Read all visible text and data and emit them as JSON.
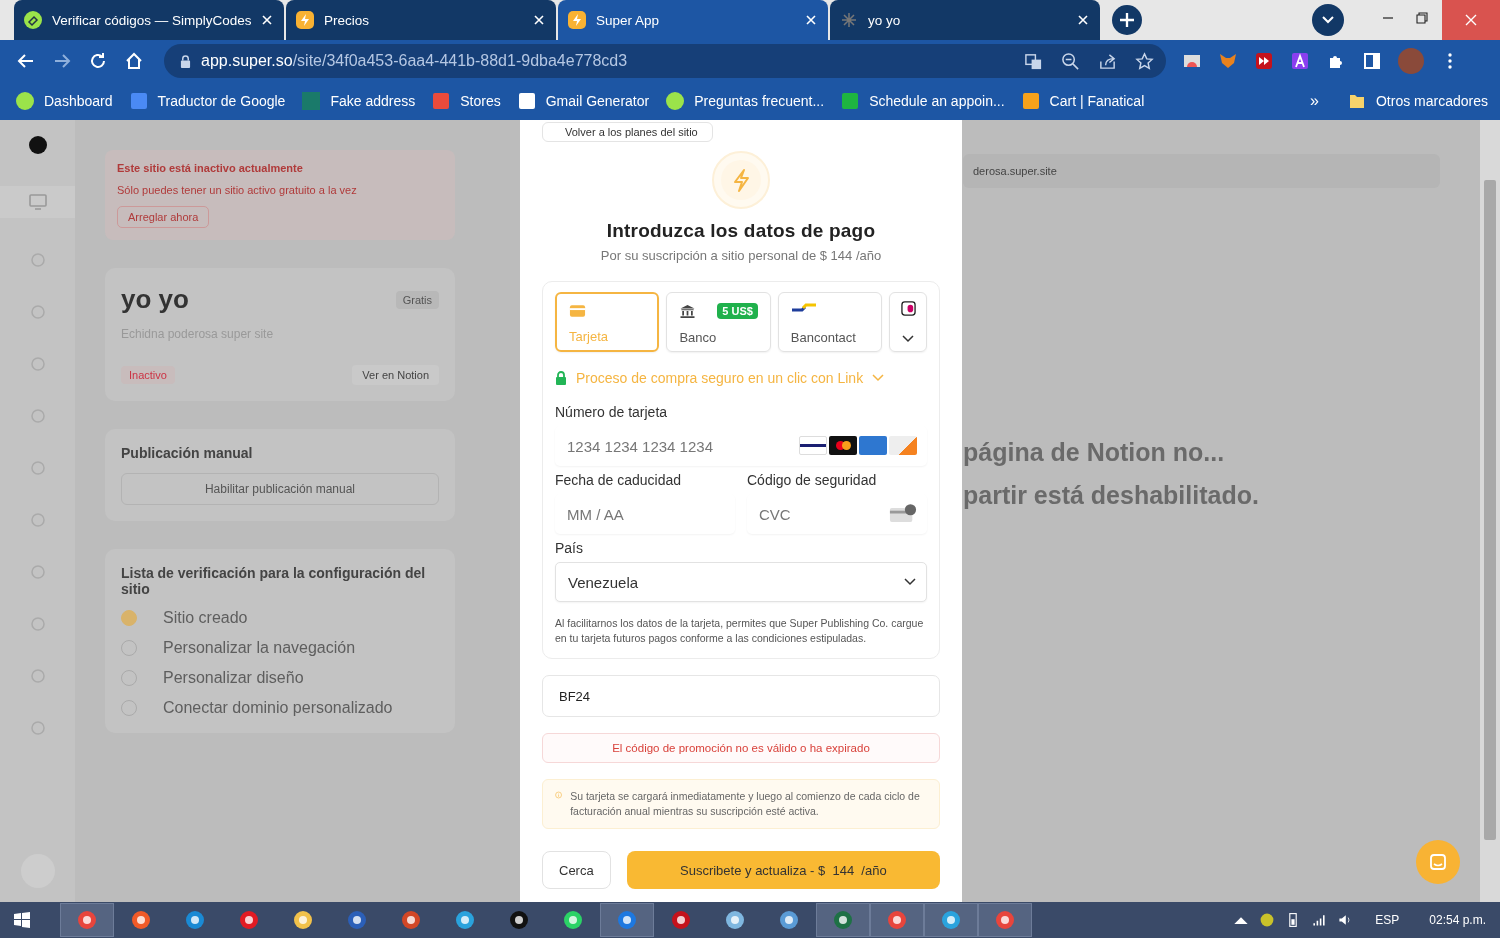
{
  "browser": {
    "tabs": [
      {
        "title": "Verificar códigos — SimplyCodes",
        "selected": false
      },
      {
        "title": "Precios",
        "selected": false
      },
      {
        "title": "Super App",
        "selected": true
      },
      {
        "title": "yo yo",
        "selected": false
      }
    ],
    "url": {
      "domain": "app.super.so",
      "path": "/site/34f0a453-6aa4-441b-88d1-9dba4e778cd3"
    },
    "bookmarks": [
      {
        "label": "Dashboard"
      },
      {
        "label": "Traductor de Google"
      },
      {
        "label": "Fake address"
      },
      {
        "label": "Stores"
      },
      {
        "label": "Gmail Generator"
      },
      {
        "label": "Preguntas frecuent..."
      },
      {
        "label": "Schedule an appoin..."
      },
      {
        "label": "Cart | Fanatical"
      }
    ],
    "bookmarks_overflow": "»",
    "other_bookmarks": "Otros marcadores"
  },
  "background": {
    "alert": {
      "title": "Este sitio está inactivo actualmente",
      "text": "Sólo puedes tener un sitio activo gratuito a la vez",
      "button": "Arreglar ahora"
    },
    "site": {
      "name": "yo yo",
      "badge": "Gratis",
      "subtitle": "Echidna poderosa super site",
      "status": "Inactivo",
      "button": "Ver en Notion"
    },
    "publishing": {
      "title": "Publicación manual",
      "button": "Habilitar publicación manual"
    },
    "checklist": {
      "title": "Lista de verificación para la configuración del sitio",
      "items": [
        {
          "label": "Sitio creado",
          "done": true
        },
        {
          "label": "Personalizar la navegación",
          "done": false
        },
        {
          "label": "Personalizar diseño",
          "done": false
        },
        {
          "label": "Conectar dominio personalizado",
          "done": false
        }
      ]
    },
    "preview": {
      "url": "derosa.super.site",
      "lines": [
        "página de Notion no...",
        "partir está deshabilitado."
      ]
    }
  },
  "modal": {
    "back": "Volver a los planes del sitio",
    "title": "Introduzca los datos de pago",
    "subtitle": "Por su suscripción a sitio personal de $ 144 /año",
    "methods": [
      {
        "label": "Tarjeta",
        "kind": "card",
        "selected": true
      },
      {
        "label": "Banco",
        "kind": "bank",
        "badge": "5 US$",
        "selected": false
      },
      {
        "label": "Bancontact",
        "kind": "bancontact",
        "selected": false
      }
    ],
    "link": "Proceso de compra seguro en un clic con Link",
    "card_number": {
      "label": "Número de tarjeta",
      "placeholder": "1234 1234 1234 1234"
    },
    "expiry": {
      "label": "Fecha de caducidad",
      "placeholder": "MM / AA"
    },
    "cvc": {
      "label": "Código de seguridad",
      "placeholder": "CVC"
    },
    "country": {
      "label": "País",
      "value": "Venezuela"
    },
    "disclaimer": "Al facilitarnos los datos de la tarjeta, permites que Super Publishing Co. cargue en tu tarjeta futuros pagos conforme a las condiciones estipuladas.",
    "promo": {
      "value": "BF24"
    },
    "error": "El código de promoción no es válido o ha expirado",
    "notice": "Su tarjeta se cargará inmediatamente y luego al comienzo de cada ciclo de facturación anual mientras su suscripción esté activa.",
    "cancel": "Cerca",
    "submit": "Suscribete y actualiza - $  144  /año"
  },
  "taskbar": {
    "language": "ESP",
    "time": "02:54 p.m."
  }
}
